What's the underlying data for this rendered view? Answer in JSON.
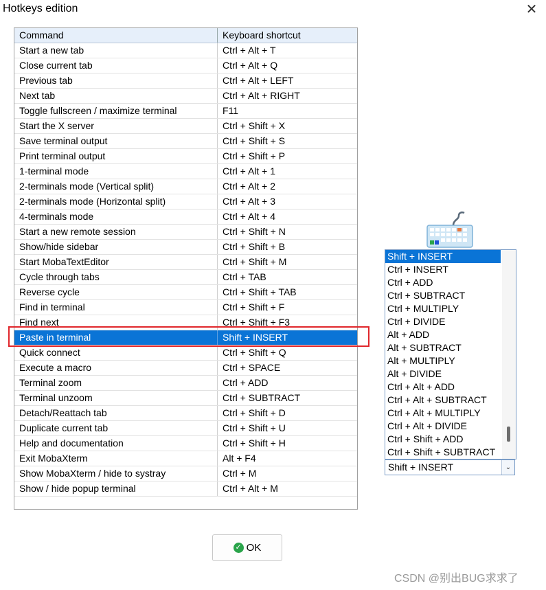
{
  "window": {
    "title": "Hotkeys edition",
    "close_glyph": "✕"
  },
  "table": {
    "headers": {
      "command": "Command",
      "shortcut": "Keyboard shortcut"
    },
    "rows": [
      {
        "command": "Start a new tab",
        "shortcut": "Ctrl + Alt + T"
      },
      {
        "command": "Close current tab",
        "shortcut": "Ctrl + Alt + Q"
      },
      {
        "command": "Previous tab",
        "shortcut": "Ctrl + Alt + LEFT"
      },
      {
        "command": "Next tab",
        "shortcut": "Ctrl + Alt + RIGHT"
      },
      {
        "command": "Toggle fullscreen / maximize terminal",
        "shortcut": "F11"
      },
      {
        "command": "Start the X server",
        "shortcut": "Ctrl + Shift + X"
      },
      {
        "command": "Save terminal output",
        "shortcut": "Ctrl + Shift + S"
      },
      {
        "command": "Print terminal output",
        "shortcut": "Ctrl + Shift + P"
      },
      {
        "command": "1-terminal mode",
        "shortcut": "Ctrl + Alt + 1"
      },
      {
        "command": "2-terminals mode (Vertical split)",
        "shortcut": "Ctrl + Alt + 2"
      },
      {
        "command": "2-terminals mode (Horizontal split)",
        "shortcut": "Ctrl + Alt + 3"
      },
      {
        "command": "4-terminals mode",
        "shortcut": "Ctrl + Alt + 4"
      },
      {
        "command": "Start a new remote session",
        "shortcut": "Ctrl + Shift + N"
      },
      {
        "command": "Show/hide sidebar",
        "shortcut": "Ctrl + Shift + B"
      },
      {
        "command": "Start MobaTextEditor",
        "shortcut": "Ctrl + Shift + M"
      },
      {
        "command": "Cycle through tabs",
        "shortcut": "Ctrl + TAB"
      },
      {
        "command": "Reverse cycle",
        "shortcut": "Ctrl + Shift + TAB"
      },
      {
        "command": "Find in terminal",
        "shortcut": "Ctrl + Shift + F"
      },
      {
        "command": "Find next",
        "shortcut": "Ctrl + Shift + F3"
      },
      {
        "command": "Paste in terminal",
        "shortcut": "Shift + INSERT",
        "selected": true
      },
      {
        "command": "Quick connect",
        "shortcut": "Ctrl + Shift + Q"
      },
      {
        "command": "Execute a macro",
        "shortcut": "Ctrl + SPACE"
      },
      {
        "command": "Terminal zoom",
        "shortcut": "Ctrl + ADD"
      },
      {
        "command": "Terminal unzoom",
        "shortcut": "Ctrl + SUBTRACT"
      },
      {
        "command": "Detach/Reattach tab",
        "shortcut": "Ctrl + Shift + D"
      },
      {
        "command": "Duplicate current tab",
        "shortcut": "Ctrl + Shift + U"
      },
      {
        "command": "Help and documentation",
        "shortcut": "Ctrl + Shift + H"
      },
      {
        "command": "Exit MobaXterm",
        "shortcut": "Alt + F4"
      },
      {
        "command": "Show MobaXterm / hide to systray",
        "shortcut": "Ctrl + M"
      },
      {
        "command": "Show / hide popup terminal",
        "shortcut": "Ctrl + Alt + M"
      }
    ]
  },
  "shortcut_list": {
    "icon": "keyboard-icon",
    "options": [
      "Shift + INSERT",
      "Ctrl + INSERT",
      "Ctrl + ADD",
      "Ctrl + SUBTRACT",
      "Ctrl + MULTIPLY",
      "Ctrl + DIVIDE",
      "Alt + ADD",
      "Alt + SUBTRACT",
      "Alt + MULTIPLY",
      "Alt + DIVIDE",
      "Ctrl + Alt + ADD",
      "Ctrl + Alt + SUBTRACT",
      "Ctrl + Alt + MULTIPLY",
      "Ctrl + Alt + DIVIDE",
      "Ctrl + Shift + ADD",
      "Ctrl + Shift + SUBTRACT"
    ],
    "selected": "Shift + INSERT",
    "dropdown_value": "Shift + INSERT",
    "dropdown_glyph": "⌄"
  },
  "buttons": {
    "ok_label": "OK",
    "ok_icon": "check-circle-icon",
    "ok_glyph": "✓"
  },
  "watermark": "CSDN @别出BUG求求了",
  "colors": {
    "selection": "#0a74d6",
    "highlight_border": "#e0262b",
    "header_bg": "#e6effa"
  }
}
